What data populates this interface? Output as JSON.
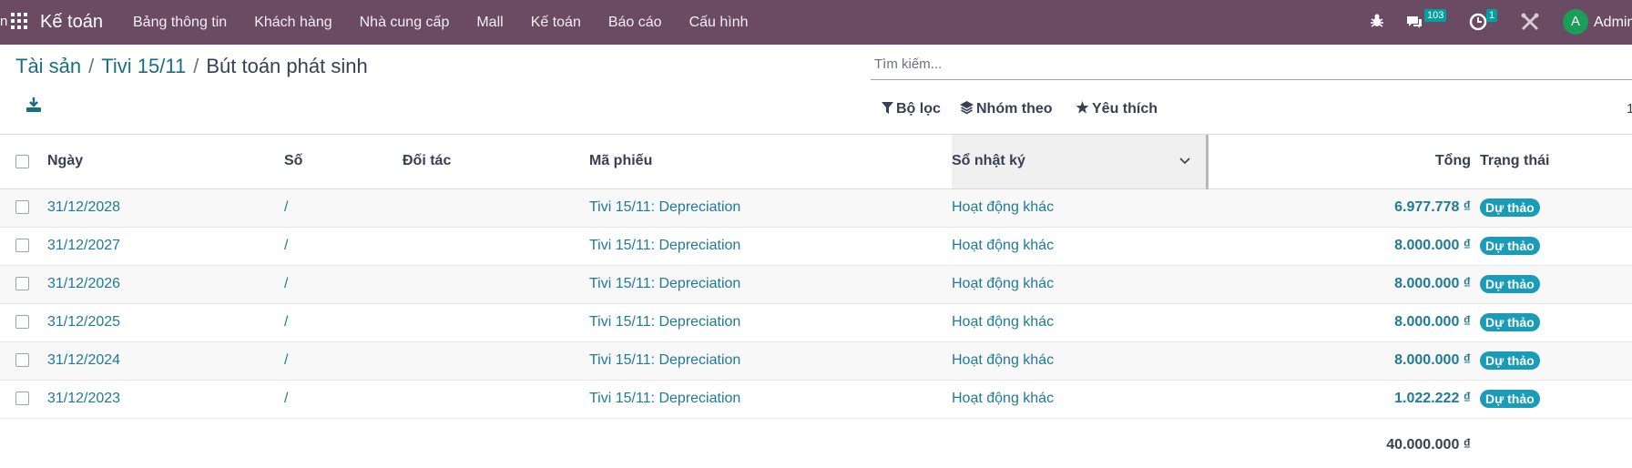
{
  "navbar": {
    "edge_text": "n",
    "brand": "Kế toán",
    "menu": [
      "Bảng thông tin",
      "Khách hàng",
      "Nhà cung cấp",
      "Mall",
      "Kế toán",
      "Báo cáo",
      "Cấu hình"
    ],
    "chat_badge": "103",
    "activity_badge": "1",
    "avatar_letter": "A",
    "user_name": "Admin"
  },
  "breadcrumb": {
    "items": [
      "Tài sản",
      "Tivi 15/11"
    ],
    "current": "Bút toán phát sinh"
  },
  "search": {
    "placeholder": "Tìm kiếm..."
  },
  "controls": {
    "filter": "Bộ lọc",
    "group_by": "Nhóm theo",
    "favorites": "Yêu thích",
    "pager": "1"
  },
  "table": {
    "headers": {
      "date": "Ngày",
      "number": "Số",
      "partner": "Đối tác",
      "reference": "Mã phiếu",
      "journal": "Sổ nhật ký",
      "total": "Tổng",
      "status": "Trạng thái"
    },
    "rows": [
      {
        "date": "31/12/2028",
        "number": "/",
        "partner": "",
        "reference": "Tivi 15/11: Depreciation",
        "journal": "Hoạt động khác",
        "total": "6.977.778 ₫",
        "status": "Dự thảo"
      },
      {
        "date": "31/12/2027",
        "number": "/",
        "partner": "",
        "reference": "Tivi 15/11: Depreciation",
        "journal": "Hoạt động khác",
        "total": "8.000.000 ₫",
        "status": "Dự thảo"
      },
      {
        "date": "31/12/2026",
        "number": "/",
        "partner": "",
        "reference": "Tivi 15/11: Depreciation",
        "journal": "Hoạt động khác",
        "total": "8.000.000 ₫",
        "status": "Dự thảo"
      },
      {
        "date": "31/12/2025",
        "number": "/",
        "partner": "",
        "reference": "Tivi 15/11: Depreciation",
        "journal": "Hoạt động khác",
        "total": "8.000.000 ₫",
        "status": "Dự thảo"
      },
      {
        "date": "31/12/2024",
        "number": "/",
        "partner": "",
        "reference": "Tivi 15/11: Depreciation",
        "journal": "Hoạt động khác",
        "total": "8.000.000 ₫",
        "status": "Dự thảo"
      },
      {
        "date": "31/12/2023",
        "number": "/",
        "partner": "",
        "reference": "Tivi 15/11: Depreciation",
        "journal": "Hoạt động khác",
        "total": "1.022.222 ₫",
        "status": "Dự thảo"
      }
    ],
    "footer_total": "40.000.000 ₫"
  }
}
